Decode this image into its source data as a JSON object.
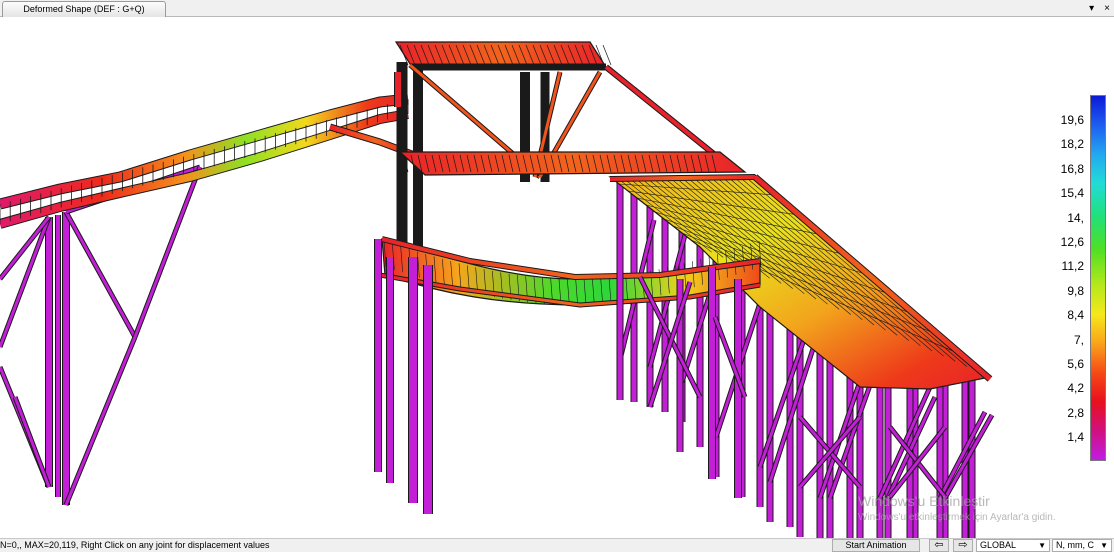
{
  "tab": {
    "title": "Deformed Shape (DEF : G+Q)"
  },
  "window_controls": {
    "dropdown_icon": "chevron-down-icon",
    "close_icon": "close-icon",
    "dropdown_glyph": "▾",
    "close_glyph": "×"
  },
  "legend": {
    "labels": [
      "19,6",
      "18,2",
      "16,8",
      "15,4",
      "14,",
      "12,6",
      "11,2",
      "9,8",
      "8,4",
      "7,",
      "5,6",
      "4,2",
      "2,8",
      "1,4"
    ],
    "top_color": "#0a1ad8",
    "bottom_color": "#c01ce4"
  },
  "colors": {
    "columns": "#c21fd6",
    "hot": "#e8222a",
    "mid": "#f2a41c",
    "cool": "#33d634",
    "outline": "#1a1a1a"
  },
  "watermark": {
    "line1": "Windows'u Etkinleştir",
    "line2": "Windows'u etkinleştirmek için Ayarlar'a gidin."
  },
  "status": {
    "text": "N=0,, MAX=20,119, Right Click on any joint for displacement values",
    "animation_button": "Start Animation",
    "prev_icon": "arrow-left-icon",
    "next_icon": "arrow-right-icon",
    "prev_glyph": "⇦",
    "next_glyph": "⇨",
    "coordinate_system": "GLOBAL",
    "units": "N, mm, C"
  }
}
